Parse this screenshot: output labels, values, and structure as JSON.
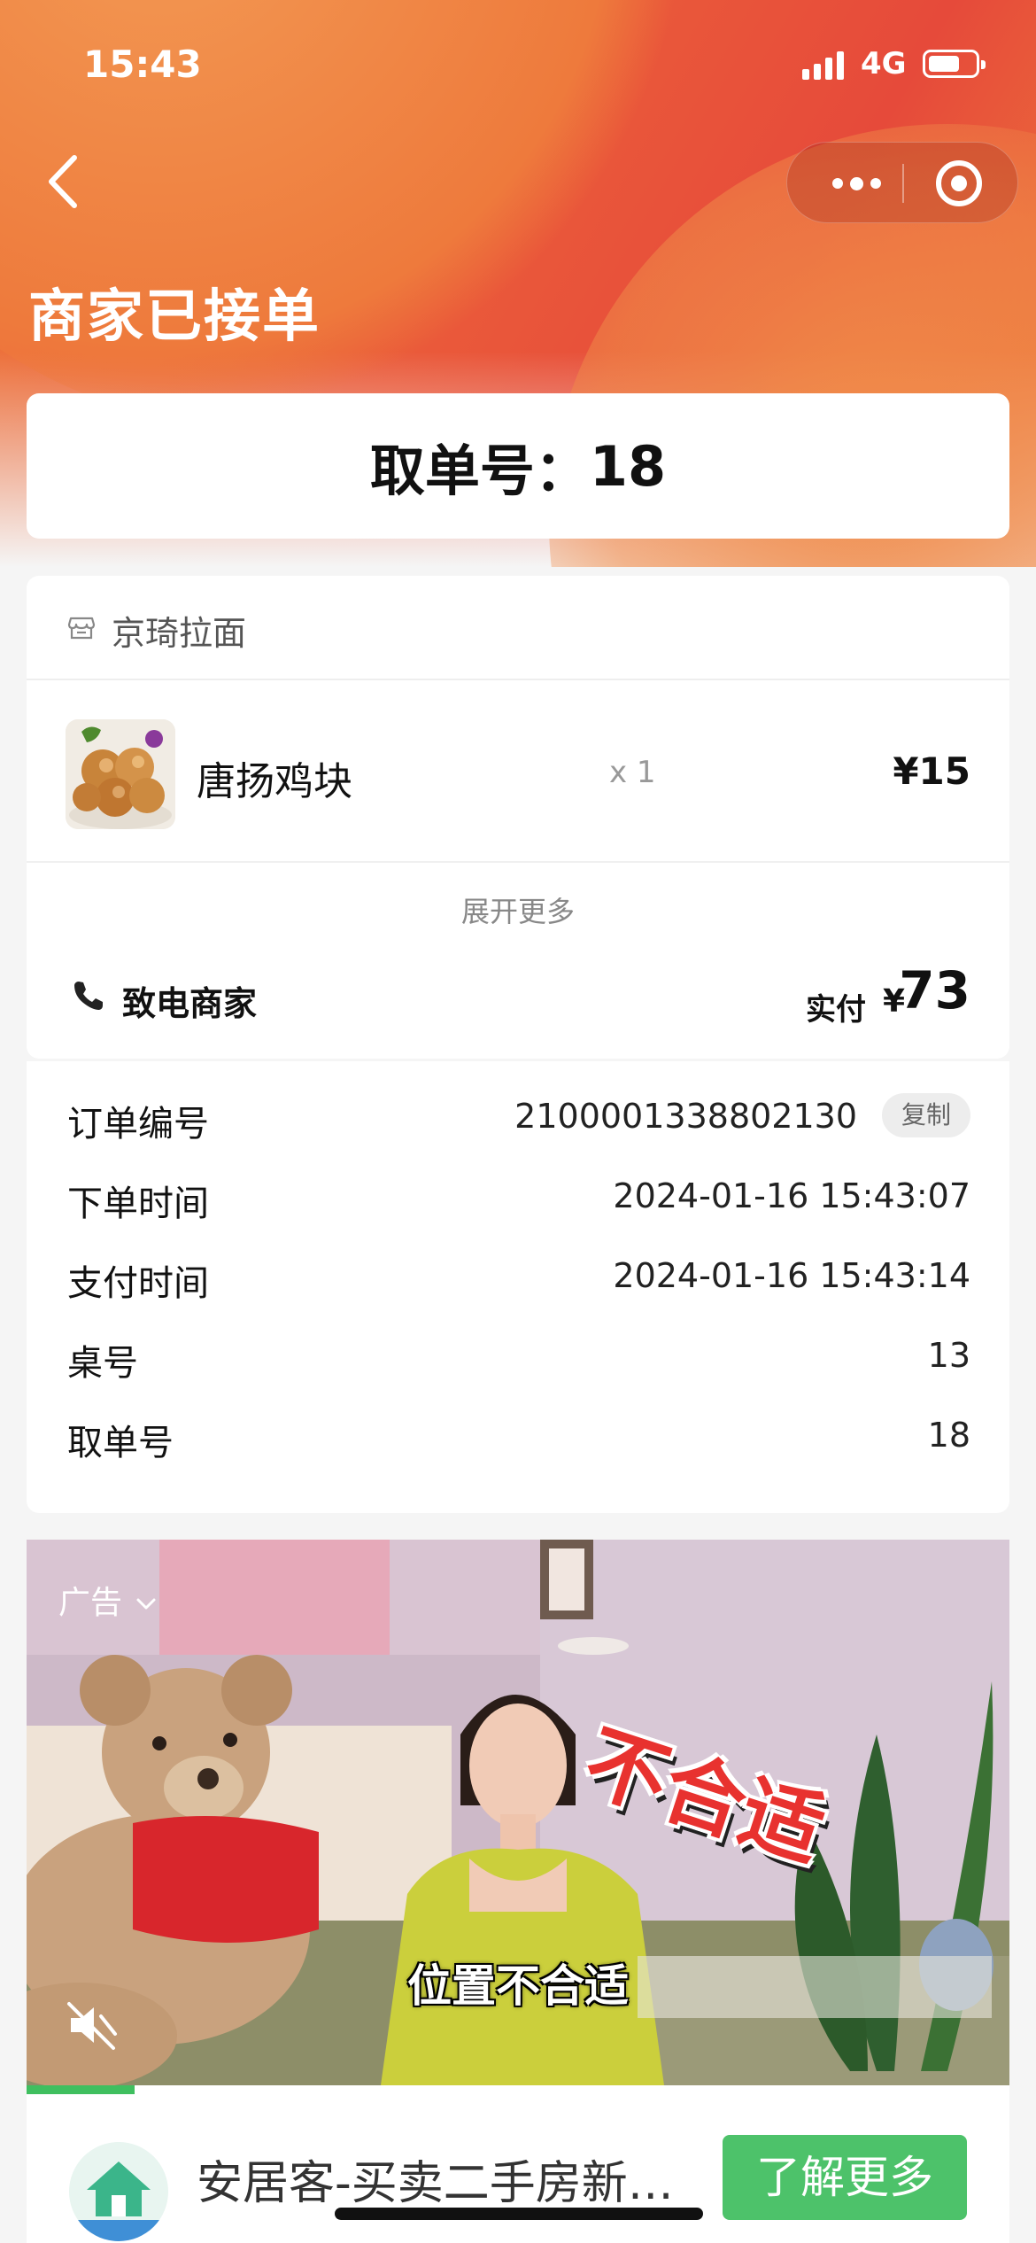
{
  "status_bar": {
    "time": "15:43",
    "network": "4G"
  },
  "colors": {
    "hero_orange": "#ee7c3c",
    "hero_red": "#e64a3a",
    "cta_green": "#4dc26a"
  },
  "nav": {
    "back_icon": "chevron-left-icon",
    "menu_icon": "more-dots-icon",
    "close_icon": "target-circle-icon"
  },
  "order_status": "商家已接单",
  "pickup": {
    "label": "取单号：",
    "number": "18"
  },
  "shop": {
    "icon": "store-icon",
    "name": "京琦拉面"
  },
  "items": [
    {
      "name": "唐扬鸡块",
      "qty": "x 1",
      "price": "¥15"
    }
  ],
  "expand_more": "展开更多",
  "contact": {
    "icon": "phone-icon",
    "label": "致电商家"
  },
  "payment": {
    "label": "实付",
    "currency": "¥",
    "amount": "73"
  },
  "details": [
    {
      "label": "订单编号",
      "value": "2100001338802130"
    },
    {
      "label": "下单时间",
      "value": "2024-01-16 15:43:07"
    },
    {
      "label": "支付时间",
      "value": "2024-01-16 15:43:14"
    },
    {
      "label": "桌号",
      "value": "13"
    },
    {
      "label": "取单号",
      "value": "18"
    }
  ],
  "copy_button": "复制",
  "ad": {
    "label": "广告",
    "sticker_text": "不合适",
    "caption": "位置不合适",
    "progress_fraction": 0.11,
    "title": "安居客-买卖二手房新…",
    "cta": "了解更多"
  }
}
